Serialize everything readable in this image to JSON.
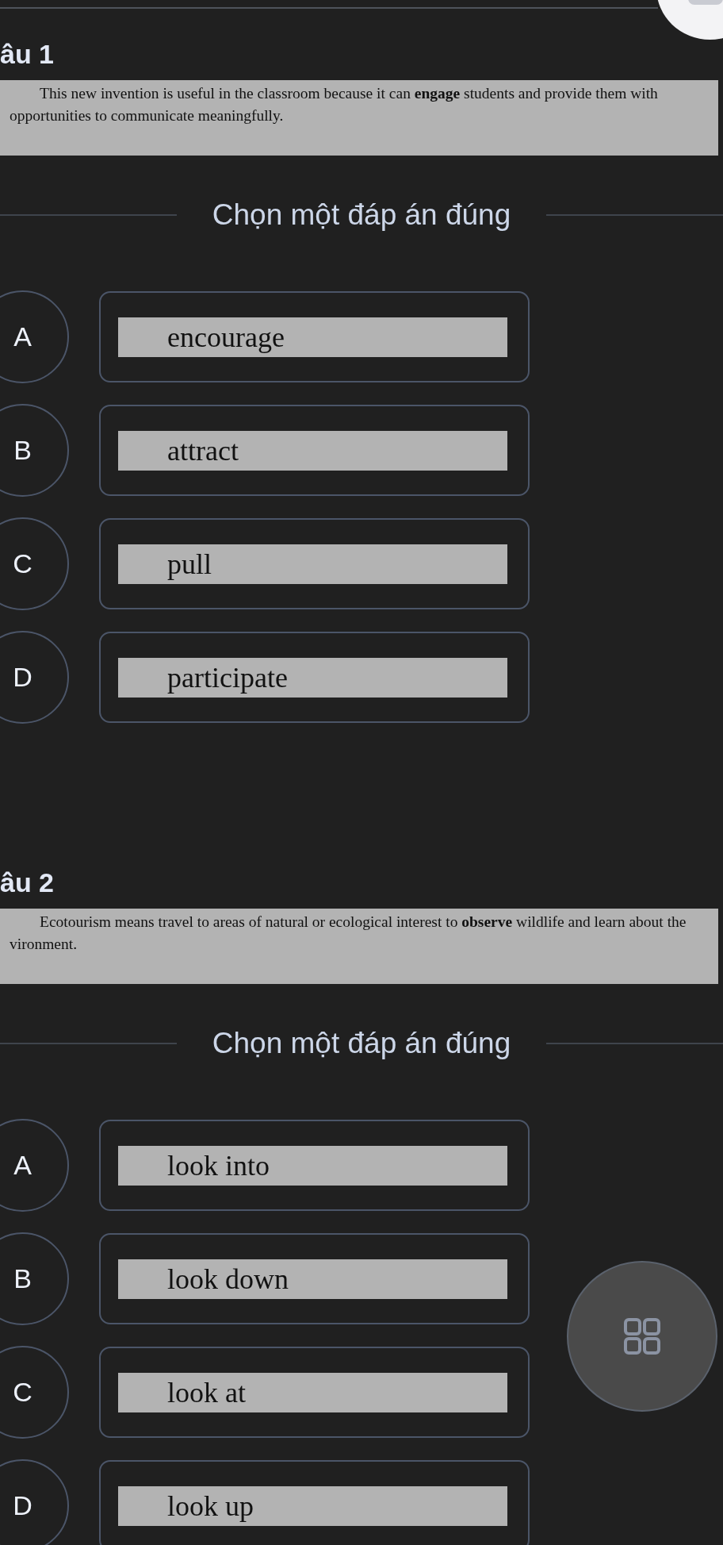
{
  "questions": [
    {
      "heading": "âu 1",
      "text_lines": [
        "This new invention is useful in the classroom because it can **engage** students and provide them with",
        "opportunities to communicate meaningfully."
      ],
      "instruction": "Chọn một đáp án đúng",
      "options": [
        {
          "letter": "A",
          "answer": "encourage"
        },
        {
          "letter": "B",
          "answer": "attract"
        },
        {
          "letter": "C",
          "answer": "pull"
        },
        {
          "letter": "D",
          "answer": "participate"
        }
      ]
    },
    {
      "heading": "âu 2",
      "text_lines": [
        "Ecotourism means travel to areas of natural or ecological interest to **observe** wildlife and learn about the",
        "vironment."
      ],
      "instruction": "Chọn một đáp án đúng",
      "options": [
        {
          "letter": "A",
          "answer": "look into"
        },
        {
          "letter": "B",
          "answer": "look down"
        },
        {
          "letter": "C",
          "answer": "look at"
        },
        {
          "letter": "D",
          "answer": "look up"
        }
      ]
    }
  ]
}
